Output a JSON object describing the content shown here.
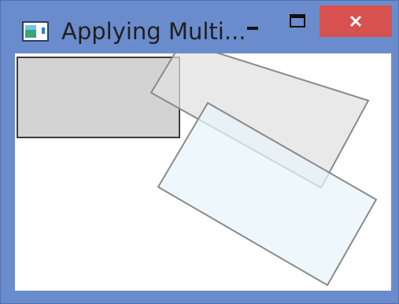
{
  "window": {
    "title": "Applying Multi..."
  },
  "titlebar_buttons": {
    "minimize_icon": "minimize-icon",
    "maximize_icon": "maximize-icon",
    "close_icon": "close-icon",
    "close_color": "#d7514f"
  },
  "colors": {
    "frame": "#6b8ccc",
    "client_background": "#ffffff",
    "rect_gray": "#d3d3d3",
    "rect_light_gray": "#e6e6e6",
    "rect_light_blue": "#eef7fb"
  }
}
